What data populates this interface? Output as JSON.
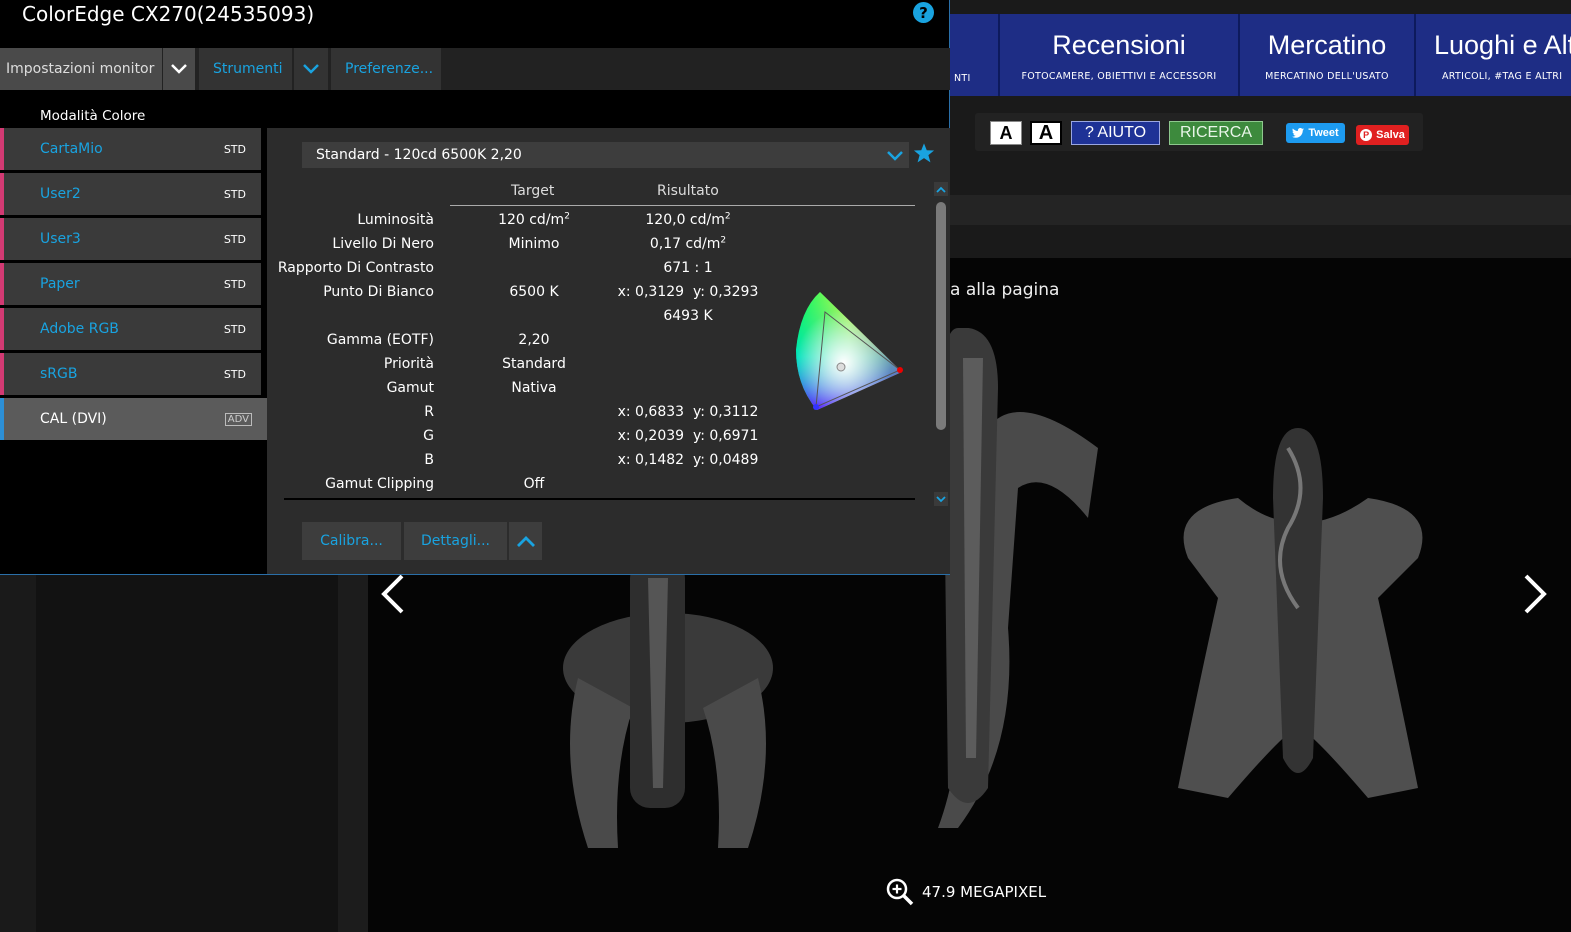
{
  "window": {
    "title": "ColorEdge CX270(24535093)",
    "help_icon": "help-icon"
  },
  "menubar": {
    "monitor_settings": "Impostazioni monitor",
    "tools": "Strumenti",
    "preferences": "Preferenze..."
  },
  "color_modes": {
    "heading": "Modalità Colore",
    "items": [
      {
        "name": "CartaMio",
        "type": "STD",
        "active": false
      },
      {
        "name": "User2",
        "type": "STD",
        "active": false
      },
      {
        "name": "User3",
        "type": "STD",
        "active": false
      },
      {
        "name": "Paper",
        "type": "STD",
        "active": false
      },
      {
        "name": "Adobe RGB",
        "type": "STD",
        "active": false
      },
      {
        "name": "sRGB",
        "type": "STD",
        "active": false
      },
      {
        "name": "CAL (DVI)",
        "type": "ADV",
        "active": true
      }
    ]
  },
  "detail": {
    "preset": "Standard - 120cd 6500K 2,20",
    "col_target": "Target",
    "col_result": "Risultato",
    "rows": [
      {
        "label": "Luminosità",
        "target": "120 cd/m",
        "target_sup": "2",
        "result": "120,0 cd/m",
        "result_sup": "2"
      },
      {
        "label": "Livello Di Nero",
        "target": "Minimo",
        "target_sup": "",
        "result": "0,17 cd/m",
        "result_sup": "2"
      },
      {
        "label": "Rapporto Di Contrasto",
        "target": "",
        "target_sup": "",
        "result": "671 : 1",
        "result_sup": ""
      },
      {
        "label": "Punto Di Bianco",
        "target": "6500 K",
        "target_sup": "",
        "result": "x: 0,3129  y: 0,3293",
        "result_sup": ""
      },
      {
        "label": "",
        "target": "",
        "target_sup": "",
        "result": "6493 K",
        "result_sup": ""
      },
      {
        "label": "Gamma (EOTF)",
        "target": "2,20",
        "target_sup": "",
        "result": "",
        "result_sup": ""
      },
      {
        "label": "Priorità",
        "target": "Standard",
        "target_sup": "",
        "result": "",
        "result_sup": ""
      },
      {
        "label": "Gamut",
        "target": "Nativa",
        "target_sup": "",
        "result": "",
        "result_sup": ""
      },
      {
        "label": "R",
        "target": "",
        "target_sup": "",
        "result": "x: 0,6833  y: 0,3112",
        "result_sup": ""
      },
      {
        "label": "G",
        "target": "",
        "target_sup": "",
        "result": "x: 0,2039  y: 0,6971",
        "result_sup": ""
      },
      {
        "label": "B",
        "target": "",
        "target_sup": "",
        "result": "x: 0,1482  y: 0,0489",
        "result_sup": ""
      },
      {
        "label": "Gamut Clipping",
        "target": "Off",
        "target_sup": "",
        "result": "",
        "result_sup": ""
      }
    ],
    "calibrate_button": "Calibra...",
    "details_button": "Dettagli..."
  },
  "site": {
    "nav": [
      {
        "title": "",
        "subtitle": "NTI"
      },
      {
        "title": "Recensioni",
        "subtitle": "FOTOCAMERE, OBIETTIVI E ACCESSORI"
      },
      {
        "title": "Mercatino",
        "subtitle": "MERCATINO DELL'USATO"
      },
      {
        "title": "Luoghi e Altr",
        "subtitle": "ARTICOLI, #TAG E ALTRI"
      }
    ],
    "toolbar": {
      "font_small": "A",
      "font_large": "A",
      "help": "? AIUTO",
      "search": "RICERCA",
      "tweet": "Tweet",
      "save": "Salva"
    },
    "photo_caption": "a alla pagina",
    "megapixel": "47.9 MEGAPIXEL"
  }
}
